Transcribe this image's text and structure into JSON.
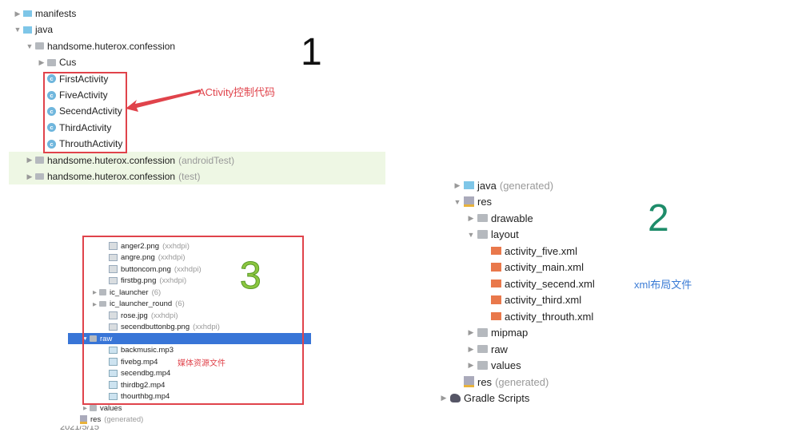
{
  "panel1": {
    "number": "1",
    "annotation": "ACtivity控制代码",
    "rows": [
      {
        "level": 0,
        "arrow": "right",
        "icon": "folder-blue",
        "name": "manifests"
      },
      {
        "level": 0,
        "arrow": "down",
        "icon": "folder-blue",
        "name": "java"
      },
      {
        "level": 1,
        "arrow": "down",
        "icon": "folder",
        "name": "handsome.huterox.confession"
      },
      {
        "level": 2,
        "arrow": "right",
        "icon": "folder",
        "name": "Cus"
      },
      {
        "level": 2,
        "arrow": "none",
        "icon": "class",
        "name": "FirstActivity"
      },
      {
        "level": 2,
        "arrow": "none",
        "icon": "class",
        "name": "FiveActivity"
      },
      {
        "level": 2,
        "arrow": "none",
        "icon": "class",
        "name": "SecendActivity"
      },
      {
        "level": 2,
        "arrow": "none",
        "icon": "class",
        "name": "ThirdActivity"
      },
      {
        "level": 2,
        "arrow": "none",
        "icon": "class",
        "name": "ThrouthActivity"
      },
      {
        "level": 1,
        "arrow": "right",
        "icon": "folder",
        "name": "handsome.huterox.confession",
        "suffix": "(androidTest)"
      },
      {
        "level": 1,
        "arrow": "right",
        "icon": "folder",
        "name": "handsome.huterox.confession",
        "suffix": "(test)"
      }
    ]
  },
  "panel2": {
    "number": "2",
    "annotation": "xml布局文件",
    "rows": [
      {
        "level": 0,
        "arrow": "right",
        "icon": "folder-blue",
        "name": "java",
        "suffix": "(generated)"
      },
      {
        "level": 0,
        "arrow": "down",
        "icon": "res",
        "name": "res"
      },
      {
        "level": 1,
        "arrow": "right",
        "icon": "folder",
        "name": "drawable"
      },
      {
        "level": 1,
        "arrow": "down",
        "icon": "folder",
        "name": "layout"
      },
      {
        "level": 2,
        "arrow": "none",
        "icon": "xml",
        "name": "activity_five.xml"
      },
      {
        "level": 2,
        "arrow": "none",
        "icon": "xml",
        "name": "activity_main.xml"
      },
      {
        "level": 2,
        "arrow": "none",
        "icon": "xml",
        "name": "activity_secend.xml"
      },
      {
        "level": 2,
        "arrow": "none",
        "icon": "xml",
        "name": "activity_third.xml"
      },
      {
        "level": 2,
        "arrow": "none",
        "icon": "xml",
        "name": "activity_throuth.xml"
      },
      {
        "level": 1,
        "arrow": "right",
        "icon": "folder",
        "name": "mipmap"
      },
      {
        "level": 1,
        "arrow": "right",
        "icon": "folder",
        "name": "raw"
      },
      {
        "level": 1,
        "arrow": "right",
        "icon": "folder",
        "name": "values"
      },
      {
        "level": 0,
        "arrow": "none",
        "icon": "res",
        "name": "res",
        "suffix": "(generated)"
      },
      {
        "level": -1,
        "arrow": "right",
        "icon": "gradle",
        "name": "Gradle Scripts"
      }
    ]
  },
  "panel3": {
    "number": "3",
    "annotation": "媒体资源文件",
    "date": "2021/5/15",
    "rows": [
      {
        "level": 2,
        "arrow": "none",
        "icon": "file",
        "name": "anger2.png",
        "suffix": "(xxhdpi)"
      },
      {
        "level": 2,
        "arrow": "none",
        "icon": "file",
        "name": "angre.png",
        "suffix": "(xxhdpi)"
      },
      {
        "level": 2,
        "arrow": "none",
        "icon": "file",
        "name": "buttoncom.png",
        "suffix": "(xxhdpi)"
      },
      {
        "level": 2,
        "arrow": "none",
        "icon": "file",
        "name": "firstbg.png",
        "suffix": "(xxhdpi)"
      },
      {
        "level": 1,
        "arrow": "right",
        "icon": "folder",
        "name": "ic_launcher",
        "suffix": "(6)"
      },
      {
        "level": 1,
        "arrow": "right",
        "icon": "folder",
        "name": "ic_launcher_round",
        "suffix": "(6)"
      },
      {
        "level": 2,
        "arrow": "none",
        "icon": "file",
        "name": "rose.jpg",
        "suffix": "(xxhdpi)"
      },
      {
        "level": 2,
        "arrow": "none",
        "icon": "file",
        "name": "secendbuttonbg.png",
        "suffix": "(xxhdpi)"
      },
      {
        "level": 0,
        "arrow": "down",
        "icon": "folder",
        "name": "raw",
        "selected": true
      },
      {
        "level": 2,
        "arrow": "none",
        "icon": "media",
        "name": "backmusic.mp3"
      },
      {
        "level": 2,
        "arrow": "none",
        "icon": "media",
        "name": "fivebg.mp4"
      },
      {
        "level": 2,
        "arrow": "none",
        "icon": "media",
        "name": "secendbg.mp4"
      },
      {
        "level": 2,
        "arrow": "none",
        "icon": "media",
        "name": "thirdbg2.mp4"
      },
      {
        "level": 2,
        "arrow": "none",
        "icon": "media",
        "name": "thourthbg.mp4"
      },
      {
        "level": 0,
        "arrow": "right",
        "icon": "folder",
        "name": "values"
      },
      {
        "level": -1,
        "arrow": "none",
        "icon": "res",
        "name": "res",
        "suffix": "(generated)"
      }
    ]
  }
}
